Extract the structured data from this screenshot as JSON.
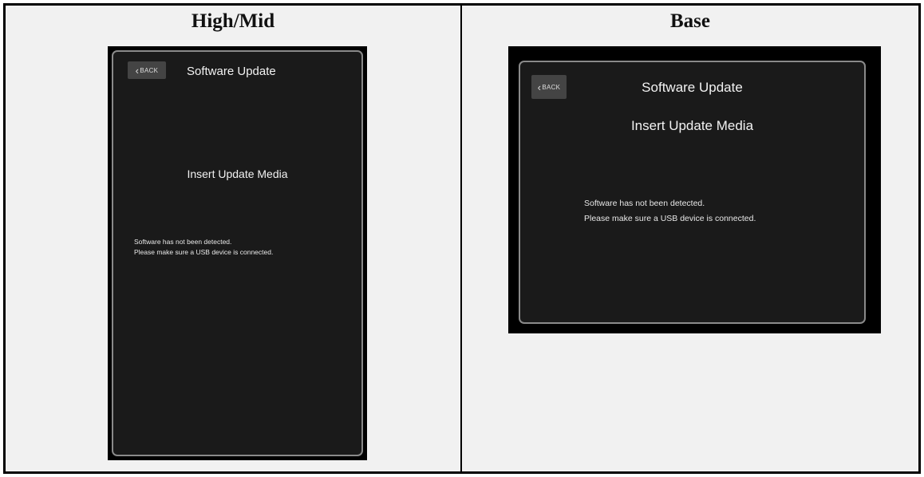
{
  "columns": {
    "left_title": "High/Mid",
    "right_title": "Base"
  },
  "high_mid": {
    "back_label": "BACK",
    "title": "Software Update",
    "heading": "Insert Update Media",
    "message_line1": "Software has not been detected.",
    "message_line2": "Please make sure a USB device is connected."
  },
  "base": {
    "back_label": "BACK",
    "title": "Software Update",
    "heading": "Insert Update Media",
    "message_line1": "Software has not been detected.",
    "message_line2": "Please make sure a USB device is connected."
  }
}
